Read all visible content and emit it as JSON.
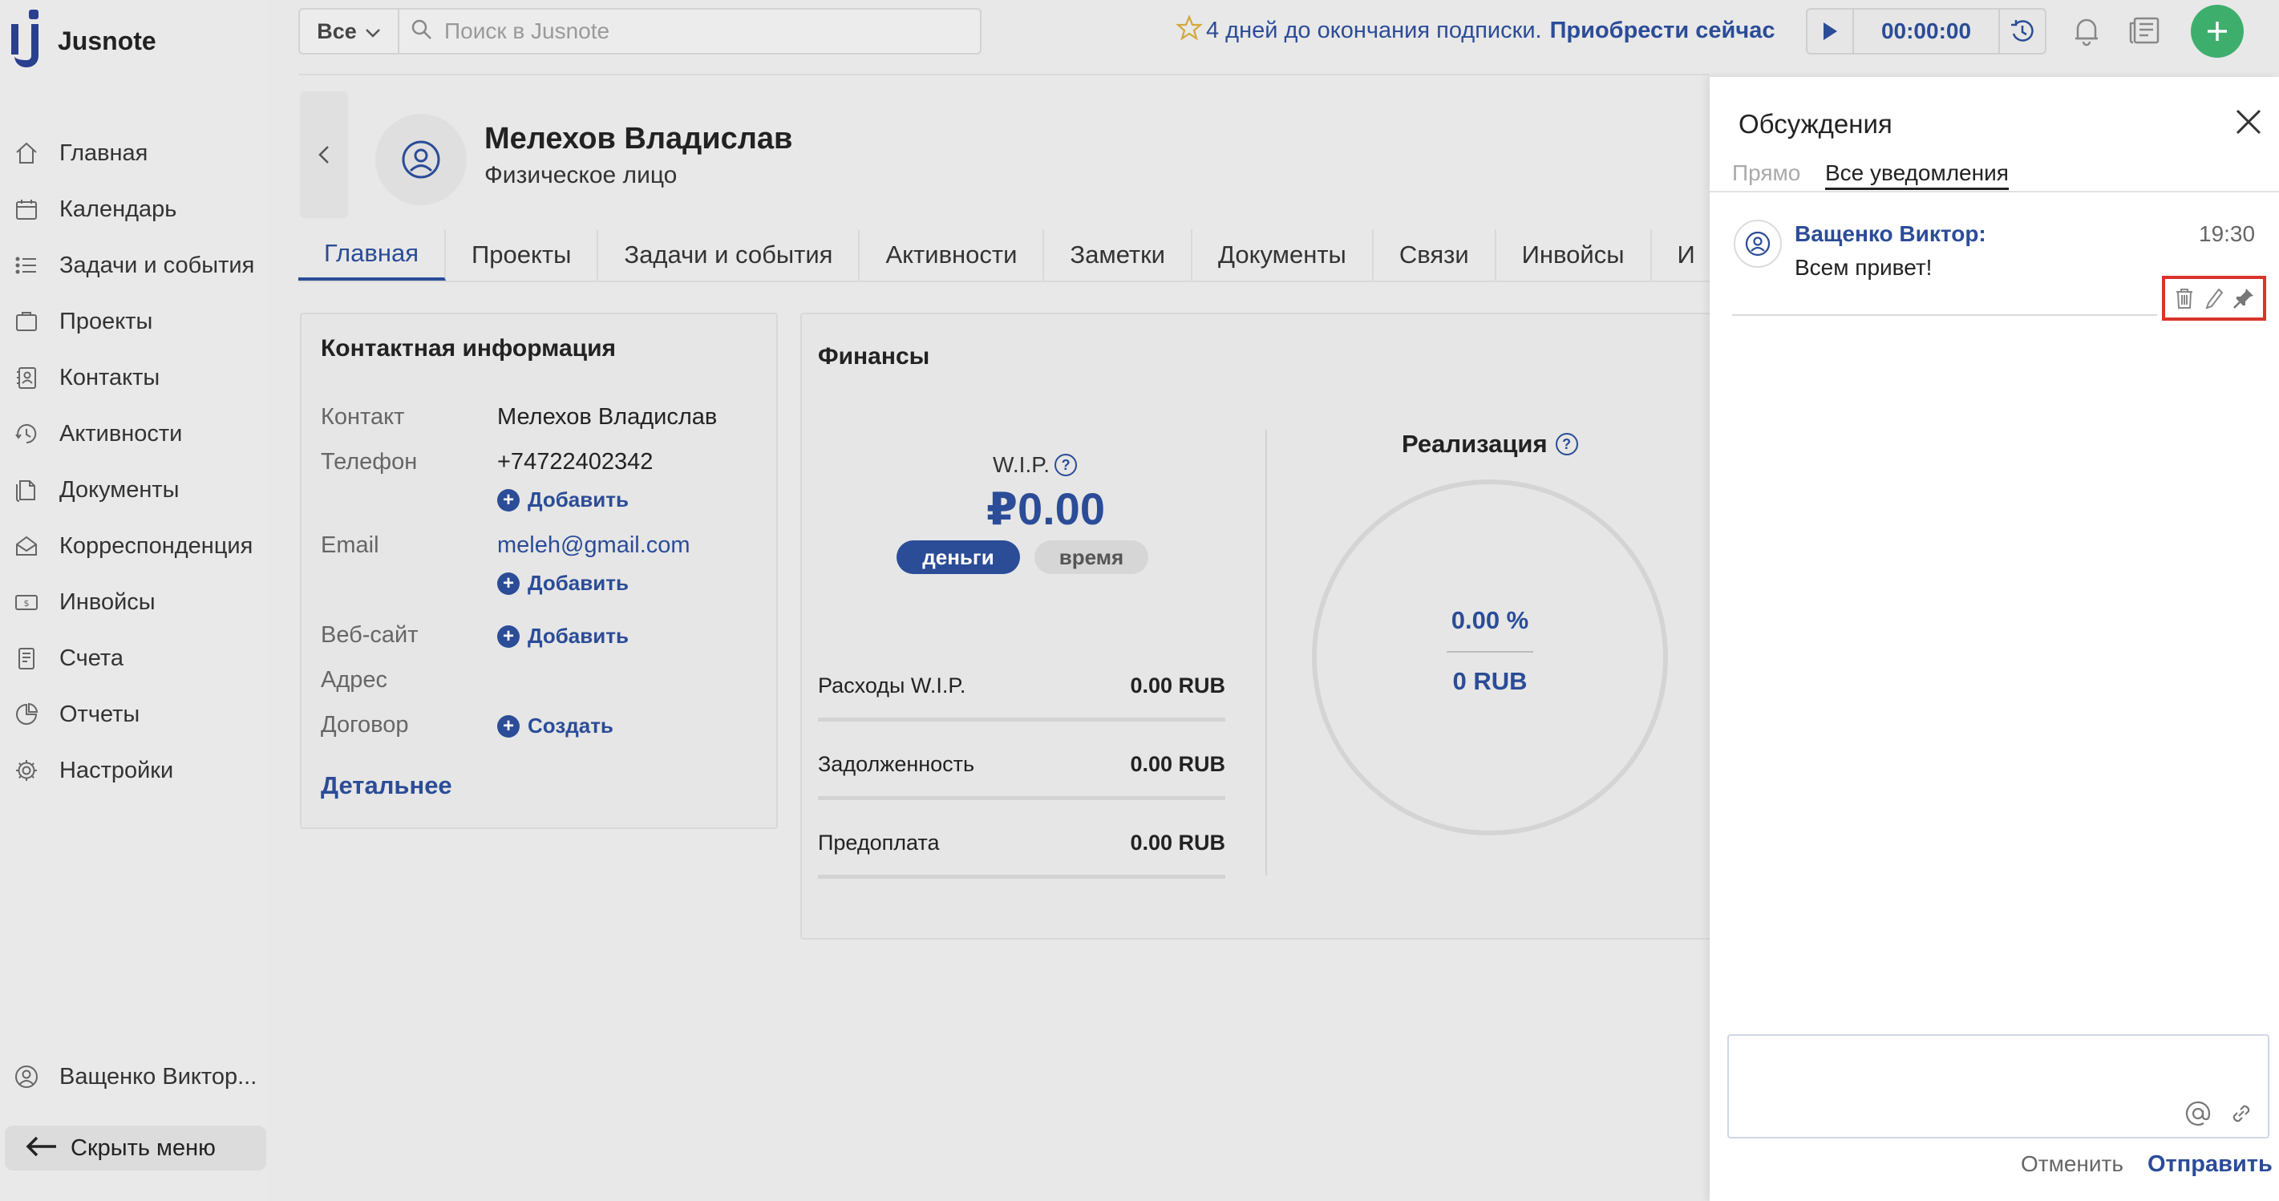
{
  "app": {
    "logo_text": "Jusnote"
  },
  "sidebar": {
    "items": [
      {
        "label": "Главная",
        "icon": "home-icon"
      },
      {
        "label": "Календарь",
        "icon": "calendar-icon"
      },
      {
        "label": "Задачи и события",
        "icon": "tasks-icon"
      },
      {
        "label": "Проекты",
        "icon": "projects-icon"
      },
      {
        "label": "Контакты",
        "icon": "contacts-icon"
      },
      {
        "label": "Активности",
        "icon": "activity-icon"
      },
      {
        "label": "Документы",
        "icon": "documents-icon"
      },
      {
        "label": "Корреспонденция",
        "icon": "mail-icon"
      },
      {
        "label": "Инвойсы",
        "icon": "invoice-icon"
      },
      {
        "label": "Счета",
        "icon": "accounts-icon"
      },
      {
        "label": "Отчеты",
        "icon": "reports-icon"
      },
      {
        "label": "Настройки",
        "icon": "settings-icon"
      }
    ],
    "user_name": "Ващенко Виктор...",
    "hide_menu": "Скрыть меню"
  },
  "topbar": {
    "filter_label": "Все",
    "search_placeholder": "Поиск в Jusnote",
    "promo_text": "4 дней до окончания подписки.",
    "promo_link": "Приобрести сейчас",
    "timer_value": "00:00:00"
  },
  "contact": {
    "name": "Мелехов Владислав",
    "type": "Физическое лицо"
  },
  "tabs": [
    "Главная",
    "Проекты",
    "Задачи и события",
    "Активности",
    "Заметки",
    "Документы",
    "Связи",
    "Инвойсы",
    "И"
  ],
  "info": {
    "title": "Контактная информация",
    "contact_label": "Контакт",
    "contact_value": "Мелехов Владислав",
    "phone_label": "Телефон",
    "phone_value": "+74722402342",
    "email_label": "Email",
    "email_value": "meleh@gmail.com",
    "website_label": "Веб-сайт",
    "address_label": "Адрес",
    "contract_label": "Договор",
    "add_label": "Добавить",
    "create_label": "Создать",
    "details_link": "Детальнее"
  },
  "finance": {
    "title": "Финансы",
    "wip_label": "W.I.P.",
    "wip_value": "₽0.00",
    "money_pill": "деньги",
    "time_pill": "время",
    "rows": [
      {
        "label": "Расходы W.I.P.",
        "value": "0.00 RUB"
      },
      {
        "label": "Задолженность",
        "value": "0.00 RUB"
      },
      {
        "label": "Предоплата",
        "value": "0.00 RUB"
      }
    ],
    "realization_title": "Реализация",
    "realization_pct": "0.00 %",
    "realization_rub": "0 RUB"
  },
  "discussion": {
    "title": "Обсуждения",
    "tab_direct": "Прямо",
    "tab_all": "Все уведомления",
    "message": {
      "author": "Ващенко Виктор:",
      "time": "19:30",
      "text": "Всем привет!"
    },
    "cancel": "Отменить",
    "send": "Отправить"
  },
  "colors": {
    "accent": "#2b4c97",
    "fab": "#3eae6d",
    "highlight": "#d9342b"
  }
}
